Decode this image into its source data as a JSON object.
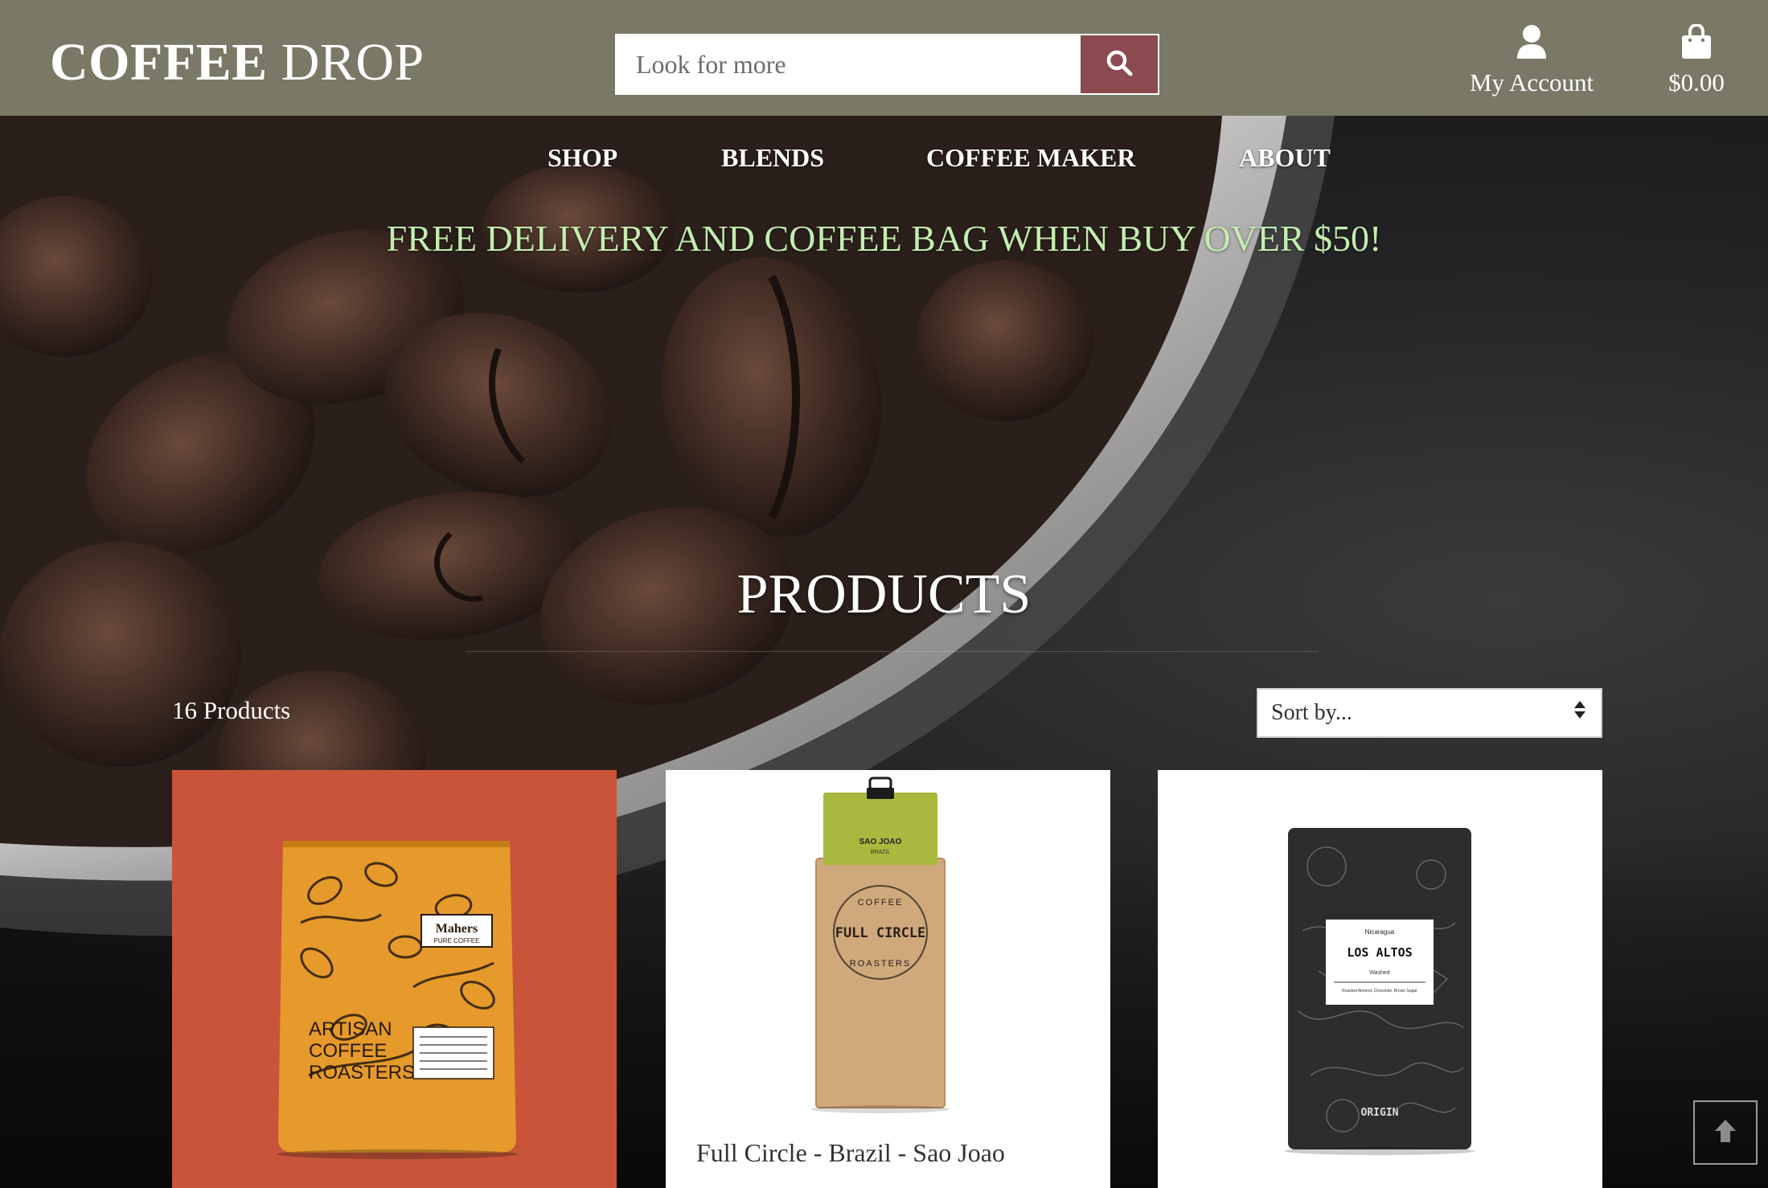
{
  "header": {
    "logo_bold": "COFFEE",
    "logo_regular": "DROP",
    "search_placeholder": "Look for more",
    "account_label": "My Account",
    "bag_total": "$0.00"
  },
  "nav": {
    "items": [
      {
        "label": "SHOP"
      },
      {
        "label": "BLENDS"
      },
      {
        "label": "COFFEE MAKER"
      },
      {
        "label": "ABOUT"
      }
    ]
  },
  "banner": "FREE DELIVERY AND COFFEE BAG WHEN BUY OVER $50!",
  "main": {
    "title": "PRODUCTS",
    "count_label": "16 Products",
    "sort_label": "Sort by..."
  },
  "products": [
    {
      "name": "",
      "bag_brand": "Mahers",
      "bag_brand_sub": "PURE COFFEE",
      "bag_text_1": "ARTISAN",
      "bag_text_2": "COFFEE",
      "bag_text_3": "ROASTERS"
    },
    {
      "name": "Full Circle - Brazil - Sao Joao",
      "bag_label_top": "SAO JOAO",
      "bag_label_sub": "BRAZIL",
      "bag_text_ring_top": "COFFEE",
      "bag_text_main_1": "FULL CIRCLE",
      "bag_text_ring_bottom": "ROASTERS"
    },
    {
      "name": "",
      "bag_label_origin": "Nicaragua",
      "bag_label_main": "LOS ALTOS",
      "bag_label_process": "Washed",
      "bag_label_notes": "Roasted Almond, Chocolate, Brown Sugar",
      "bag_brand": "ORIGIN"
    }
  ],
  "icons": {
    "search": "search-icon",
    "account": "user-icon",
    "bag": "shopping-bag-icon",
    "sort": "sort-arrows-icon",
    "to_top": "arrow-up-icon"
  },
  "colors": {
    "header_bg": "#7a7967",
    "search_button": "#8a4a4f",
    "banner_text": "#c4ecb0",
    "card1_bg": "#c8553a"
  }
}
